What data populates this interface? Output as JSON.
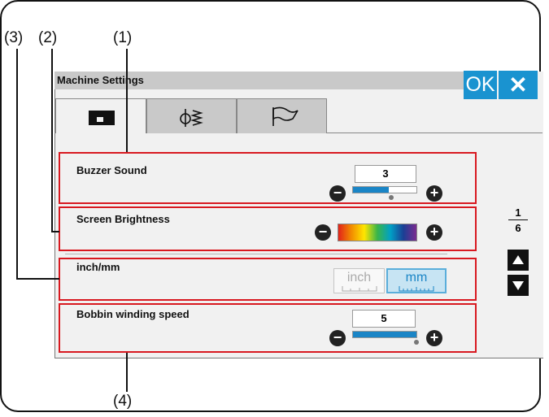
{
  "callouts": {
    "c1": "(1)",
    "c2": "(2)",
    "c3": "(3)",
    "c4": "(4)"
  },
  "window": {
    "title": "Machine Settings",
    "ok_label": "OK",
    "close_label": "✕"
  },
  "tabs": [
    {
      "icon": "sewing-machine-icon",
      "active": true
    },
    {
      "icon": "needle-thread-icon",
      "active": false
    },
    {
      "icon": "flag-icon",
      "active": false
    }
  ],
  "settings": {
    "buzzer": {
      "label": "Buzzer Sound",
      "value": "3",
      "level": 0.56
    },
    "brightness": {
      "label": "Screen Brightness"
    },
    "units": {
      "label": "inch/mm",
      "inch_label": "inch",
      "mm_label": "mm",
      "selected": "mm"
    },
    "bobbin": {
      "label": "Bobbin winding speed",
      "value": "5",
      "level": 1.0
    }
  },
  "pager": {
    "current": "1",
    "total": "6"
  },
  "controls": {
    "minus": "−",
    "plus": "+"
  },
  "colors": {
    "accent": "#1a93d0",
    "highlight": "#d81920",
    "brightness_gradient": [
      "#e2231a",
      "#f28c00",
      "#ffe600",
      "#39b54a",
      "#00a0c6",
      "#1b3f94",
      "#7b2a90"
    ]
  }
}
